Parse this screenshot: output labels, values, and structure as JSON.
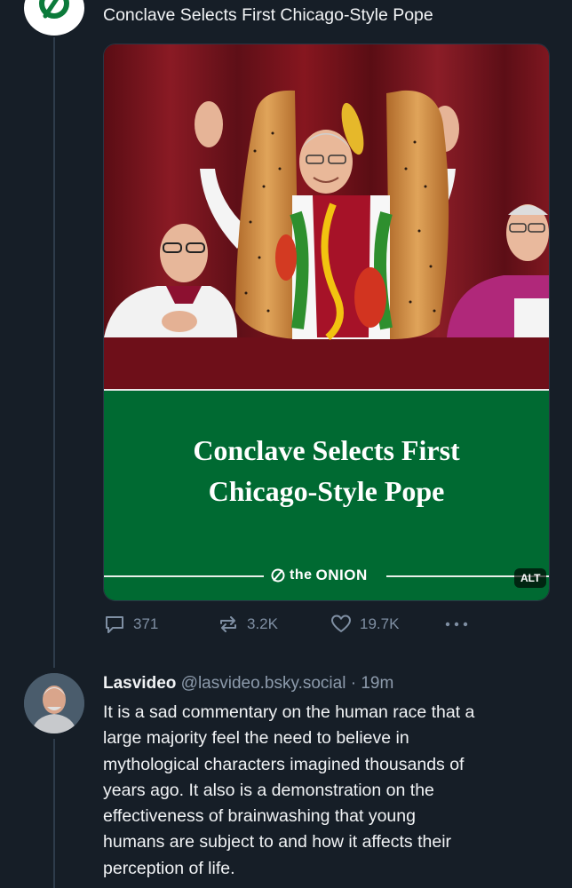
{
  "post": {
    "text": "Conclave Selects First Chicago-Style Pope",
    "card": {
      "headline_line1": "Conclave Selects First",
      "headline_line2": "Chicago-Style Pope",
      "brand_prefix": "the",
      "brand_name": "ONION",
      "alt_label": "ALT"
    },
    "actions": {
      "replies": "371",
      "reposts": "3.2K",
      "likes": "19.7K"
    }
  },
  "reply": {
    "name": "Lasvideo",
    "handle": "@lasvideo.bsky.social",
    "time": "· 19m",
    "lines": [
      "It is a sad commentary on the human race that a",
      "large majority feel the need to believe in",
      "mythological characters imagined thousands of",
      "years ago.  It also is a demonstration on the",
      "effectiveness of brainwashing that young",
      "humans are subject to and how it affects their",
      "perception of life."
    ]
  },
  "colors": {
    "background": "#161e27",
    "onion_green": "#006a32",
    "muted": "#7f8fa3"
  },
  "icons": [
    "onion-logo-icon",
    "comment-icon",
    "repost-icon",
    "heart-icon",
    "more-icon"
  ]
}
